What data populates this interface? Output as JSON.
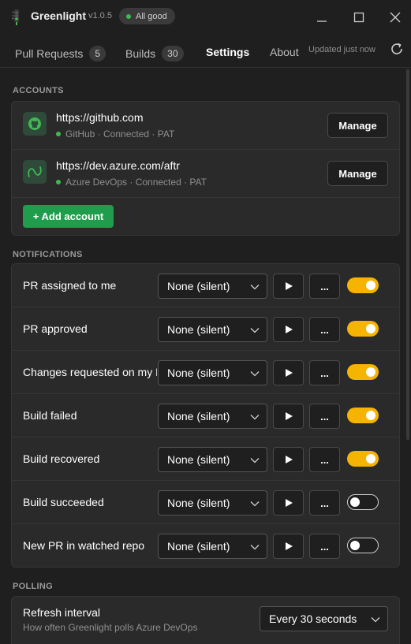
{
  "app": {
    "name": "Greenlight",
    "version": "v1.0.5",
    "status": "All good",
    "status_color": "#3fb950"
  },
  "tabs": [
    {
      "label": "Pull Requests",
      "count": "5"
    },
    {
      "label": "Builds",
      "count": "30"
    },
    {
      "label": "Settings",
      "count": null
    },
    {
      "label": "About",
      "count": null
    }
  ],
  "active_tab": "Settings",
  "updated_text": "Updated just now",
  "accounts": {
    "heading": "ACCOUNTS",
    "items": [
      {
        "url": "https://github.com",
        "meta": "GitHub · Connected · PAT",
        "icon": "github-icon",
        "manage_label": "Manage"
      },
      {
        "url": "https://dev.azure.com/aftr",
        "meta": "Azure DevOps · Connected · PAT",
        "icon": "azure-devops-icon",
        "manage_label": "Manage"
      }
    ],
    "add_label": "+ Add account"
  },
  "notifications": {
    "heading": "NOTIFICATIONS",
    "items": [
      {
        "label": "PR assigned to me",
        "sound": "None (silent)",
        "more": "...",
        "enabled": true
      },
      {
        "label": "PR approved",
        "sound": "None (silent)",
        "more": "...",
        "enabled": true
      },
      {
        "label": "Changes requested on my PR",
        "sound": "None (silent)",
        "more": "...",
        "enabled": true
      },
      {
        "label": "Build failed",
        "sound": "None (silent)",
        "more": "...",
        "enabled": true
      },
      {
        "label": "Build recovered",
        "sound": "None (silent)",
        "more": "...",
        "enabled": true
      },
      {
        "label": "Build succeeded",
        "sound": "None (silent)",
        "more": "...",
        "enabled": false
      },
      {
        "label": "New PR in watched repo",
        "sound": "None (silent)",
        "more": "...",
        "enabled": false
      }
    ]
  },
  "polling": {
    "heading": "POLLING",
    "title": "Refresh interval",
    "subtitle": "How often Greenlight polls Azure DevOps",
    "value": "Every 30 seconds"
  },
  "colors": {
    "accent_green": "#1f9d4c",
    "toggle_on": "#f5b400",
    "background": "#1f1f1f",
    "card": "#2a2a2a"
  }
}
